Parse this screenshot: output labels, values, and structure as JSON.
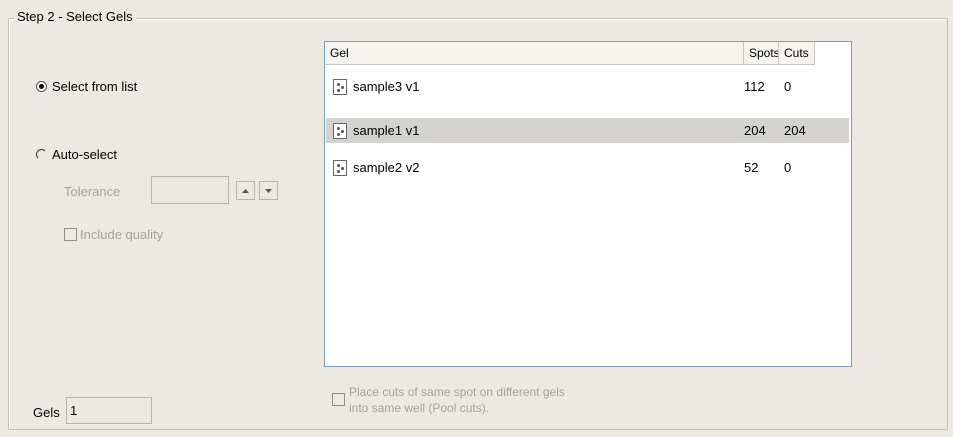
{
  "group": {
    "title": "Step 2 - Select Gels"
  },
  "options": {
    "select_from_list": "Select from list",
    "auto_select": "Auto-select",
    "tolerance_label": "Tolerance",
    "tolerance_value": "",
    "include_quality": "Include quality",
    "selected_mode": "select_from_list"
  },
  "gels_count": {
    "label": "Gels",
    "value": "1"
  },
  "list": {
    "columns": [
      "Gel",
      "Spots",
      "Cuts"
    ],
    "rows": [
      {
        "name": "sample3 v1",
        "spots": "112",
        "cuts": "0",
        "selected": false
      },
      {
        "name": "sample1 v1",
        "spots": "204",
        "cuts": "204",
        "selected": true
      },
      {
        "name": "sample2 v2",
        "spots": "52",
        "cuts": "0",
        "selected": false
      }
    ]
  },
  "pool_cuts": {
    "line1": "Place cuts of same spot on different gels",
    "line2": "into same well (Pool cuts).",
    "checked": false
  },
  "icons": {
    "gel": "gel-image-icon",
    "spin_up": "up-arrow-icon",
    "spin_down": "down-arrow-icon"
  }
}
